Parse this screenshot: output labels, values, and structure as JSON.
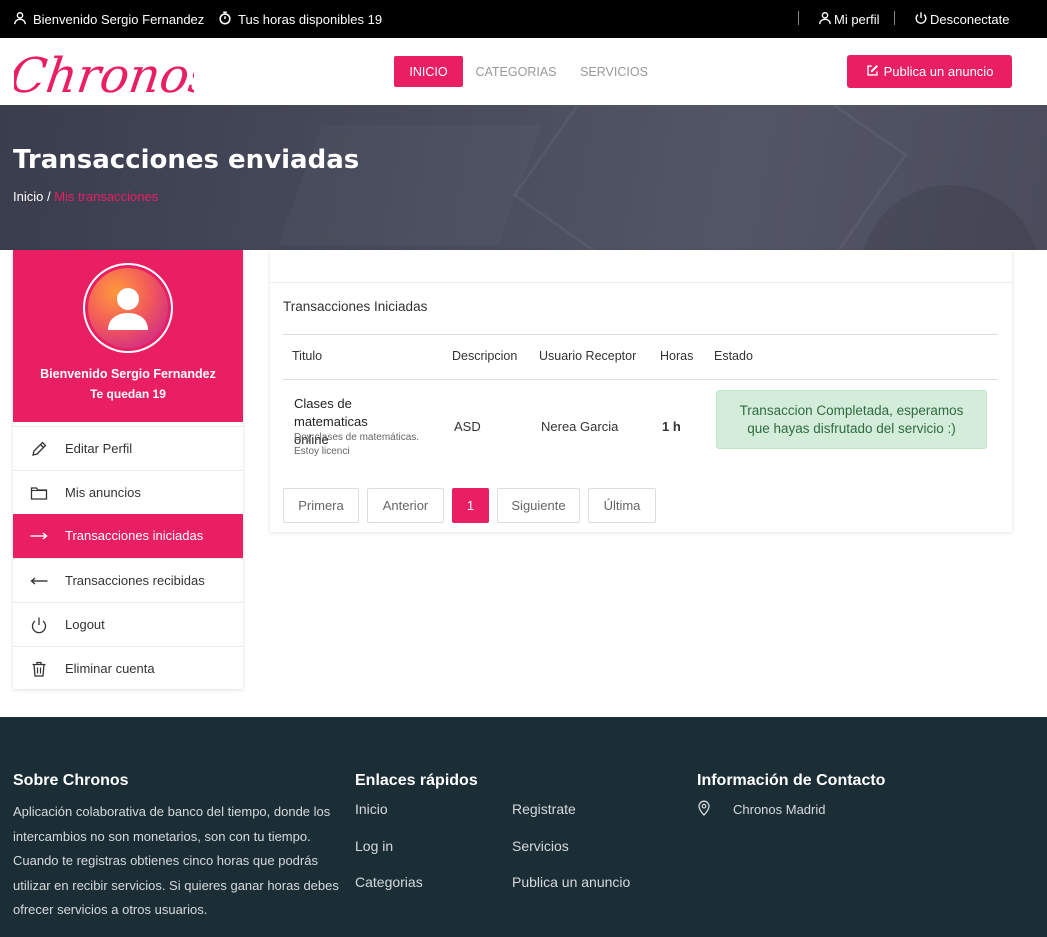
{
  "topbar": {
    "welcome": "Bienvenido Sergio Fernandez",
    "hours": "Tus horas disponibles 19",
    "profile": "Mi perfil",
    "logout": "Desconectate"
  },
  "header": {
    "logo_text": "Chronos",
    "nav": [
      "INICIO",
      "CATEGORIAS",
      "SERVICIOS"
    ],
    "publish": "Publica un anuncio"
  },
  "banner": {
    "title": "Transacciones enviadas",
    "breadcrumb_home": "Inicio /",
    "breadcrumb_current": "Mis transacciones"
  },
  "sidebar": {
    "welcome": "Bienvenido Sergio Fernandez",
    "hours": "Te quedan 19",
    "items": [
      {
        "label": "Editar Perfil",
        "icon": "pencil-icon"
      },
      {
        "label": "Mis anuncios",
        "icon": "folder-icon"
      },
      {
        "label": "Transacciones iniciadas",
        "icon": "arrow-right-icon"
      },
      {
        "label": "Transacciones recibidas",
        "icon": "arrow-left-icon"
      },
      {
        "label": "Logout",
        "icon": "power-icon"
      },
      {
        "label": "Eliminar cuenta",
        "icon": "trash-icon"
      }
    ]
  },
  "main": {
    "section_title": "Transacciones Iniciadas",
    "columns": [
      "Titulo",
      "Descripcion",
      "Usuario Receptor",
      "Horas",
      "Estado"
    ],
    "rows": [
      {
        "title": "Clases de matematicas online",
        "subtitle": "Doy clases de matemáticas. Estoy licenci",
        "description": "ASD",
        "receiver": "Nerea Garcia",
        "hours": "1 h",
        "status": "Transaccion Completada, esperamos que hayas disfrutado del servicio :)"
      }
    ],
    "pagination": [
      "Primera",
      "Anterior",
      "1",
      "Siguiente",
      "Última"
    ]
  },
  "footer": {
    "about_title": "Sobre Chronos",
    "about_text": "Aplicación colaborativa de banco del tiempo, donde los intercambios no son monetarios, son con tu tiempo. Cuando te registras obtienes cinco horas que podrás utilizar en recibir servicios. Si quieres ganar horas debes ofrecer servicios a otros usuarios.",
    "links_title": "Enlaces rápidos",
    "links": [
      "Inicio",
      "Registrate",
      "Log in",
      "Servicios",
      "Categorias",
      "Publica un anuncio"
    ],
    "contact_title": "Información de Contacto",
    "contact_location": "Chronos Madrid"
  },
  "colors": {
    "accent": "#e91e63",
    "footer_bg": "#1b2e35",
    "success_bg": "#d4edda",
    "success_text": "#306b3e"
  }
}
